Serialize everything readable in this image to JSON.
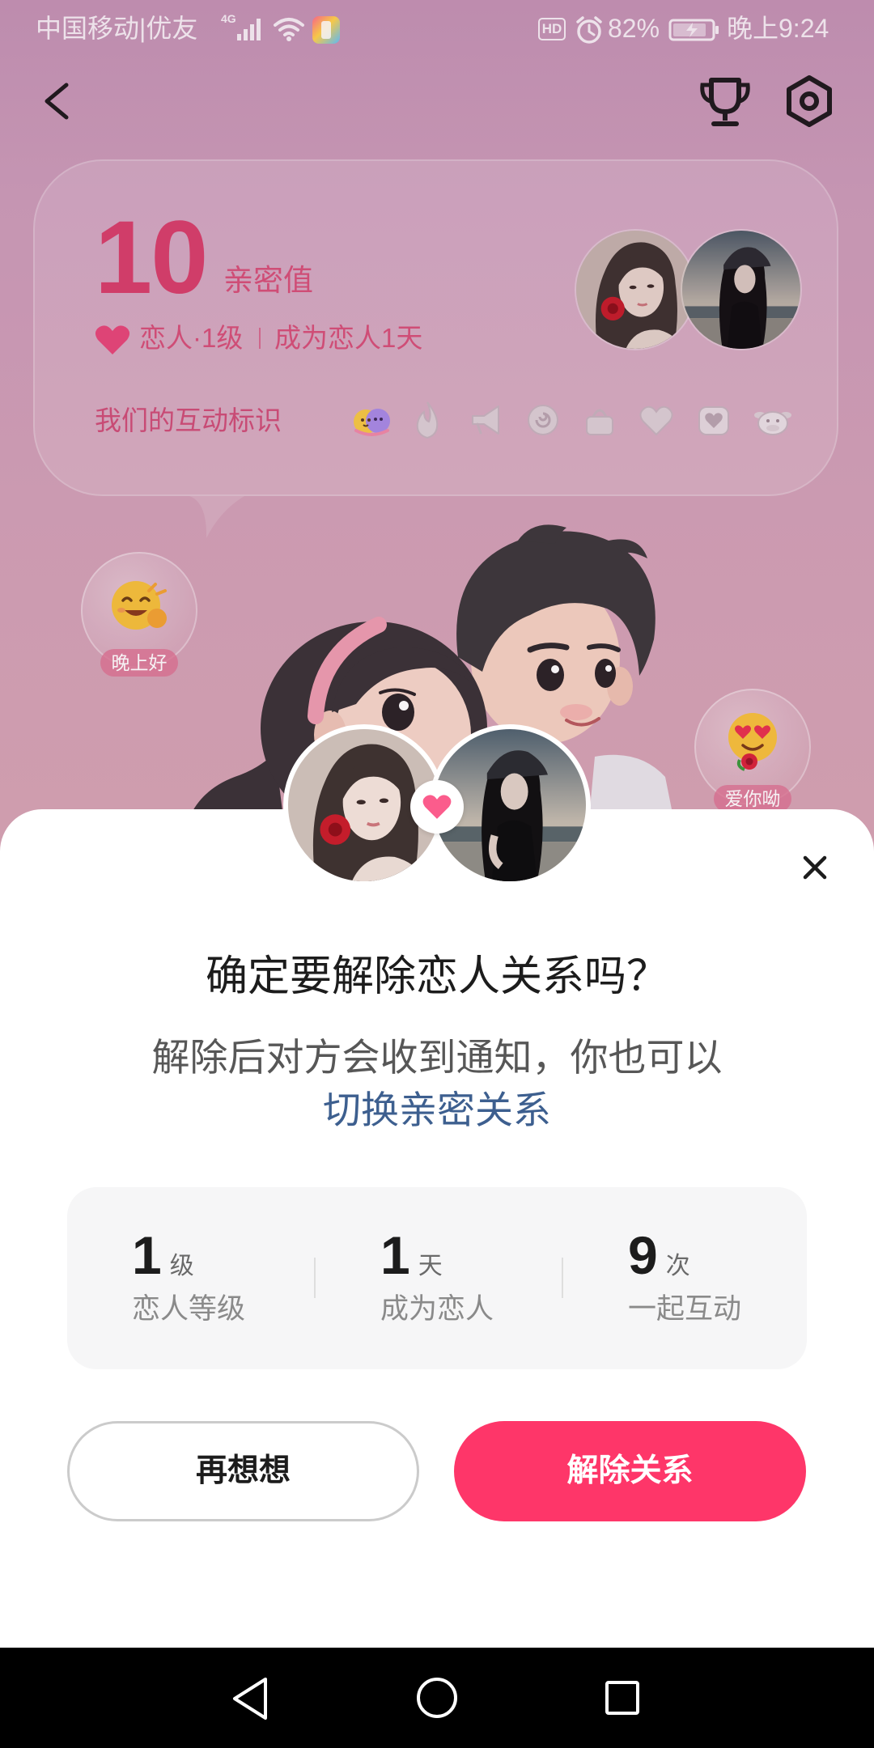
{
  "status_bar": {
    "carrier": "中国移动|优友",
    "network": "4G",
    "hd": "HD",
    "battery": "82%",
    "time": "晚上9:24",
    "icons": [
      "signal-icon",
      "wifi-icon",
      "app-notification-icon",
      "alarm-icon",
      "battery-charging-icon"
    ]
  },
  "header": {
    "icons": [
      "back-arrow-icon",
      "trophy-icon",
      "settings-icon"
    ]
  },
  "intimacy_card": {
    "value": "10",
    "value_label": "亲密值",
    "relation": "恋人·1级",
    "duration": "成为恋人1天",
    "badges_label": "我们的互动标识",
    "badges": [
      {
        "icon": "hug-badge-icon",
        "unlocked": true
      },
      {
        "icon": "flame-badge-icon",
        "unlocked": false
      },
      {
        "icon": "horn-badge-icon",
        "unlocked": false
      },
      {
        "icon": "spiral-badge-icon",
        "unlocked": false
      },
      {
        "icon": "gift-badge-icon",
        "unlocked": false
      },
      {
        "icon": "heart-badge-icon",
        "unlocked": false
      },
      {
        "icon": "heart-box-badge-icon",
        "unlocked": false
      },
      {
        "icon": "cow-badge-icon",
        "unlocked": false
      }
    ]
  },
  "stickers": [
    {
      "label": "晚上好",
      "icon": "smiling-emoji-icon"
    },
    {
      "label": "爱你呦",
      "icon": "heart-eyes-emoji-icon"
    }
  ],
  "dialog": {
    "title": "确定要解除恋人关系吗？",
    "description": "解除后对方会收到通知，你也可以",
    "link": "切换亲密关系",
    "stats": [
      {
        "value": "1",
        "unit": "级",
        "label": "恋人等级"
      },
      {
        "value": "1",
        "unit": "天",
        "label": "成为恋人"
      },
      {
        "value": "9",
        "unit": "次",
        "label": "一起互动"
      }
    ],
    "cancel_label": "再想想",
    "confirm_label": "解除关系",
    "icons": [
      "close-icon",
      "heart-icon"
    ]
  },
  "nav_bar": {
    "icons": [
      "nav-back-icon",
      "nav-home-icon",
      "nav-recents-icon"
    ]
  },
  "colors": {
    "accent": "#fe3669",
    "intimacy": "#d7406c",
    "link": "#3d5f8f",
    "background": "#d2a2b8"
  }
}
